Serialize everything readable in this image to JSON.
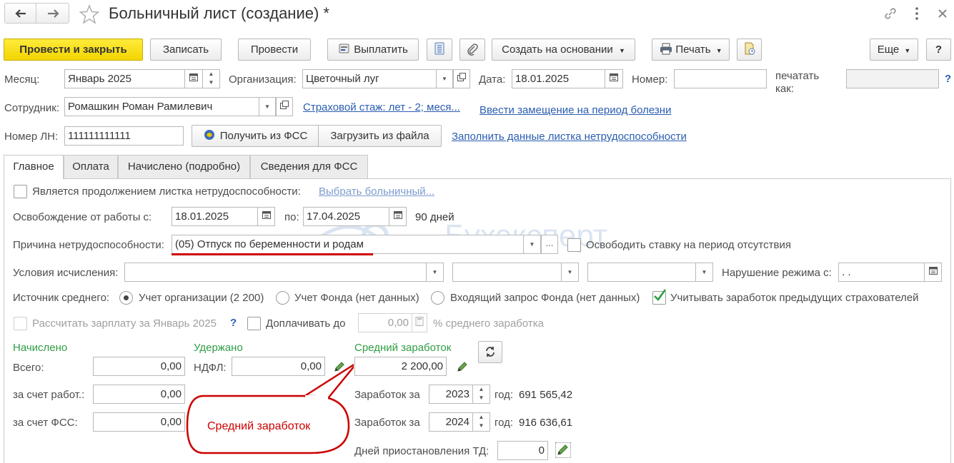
{
  "window": {
    "title": "Больничный лист (создание) *",
    "back_icon": "arrow-left-icon",
    "forward_icon": "arrow-right-icon",
    "favorite_icon": "star-icon",
    "link_icon": "link-icon",
    "more_icon": "vertical-dots-icon",
    "close_icon": "close-icon"
  },
  "toolbar": {
    "post_close": "Провести и закрыть",
    "save": "Записать",
    "post": "Провести",
    "pay": "Выплатить",
    "create_based": "Создать на основании",
    "print": "Печать",
    "more": "Еще",
    "help": "?"
  },
  "header": {
    "month_label": "Месяц:",
    "month_value": "Январь 2025",
    "org_label": "Организация:",
    "org_value": "Цветочный луг",
    "date_label": "Дата:",
    "date_value": "18.01.2025",
    "number_label": "Номер:",
    "number_value": "",
    "print_as_label": "печатать как:",
    "print_as_value": "",
    "help_q": "?",
    "employee_label": "Сотрудник:",
    "employee_value": "Ромашкин Роман Рамилевич",
    "insurance_link": "Страховой стаж: лет - 2; меся...",
    "substitute_link": "Ввести замещение на период болезни",
    "ln_label": "Номер ЛН:",
    "ln_value": "111111111111",
    "get_fss": "Получить из ФСС",
    "load_file": "Загрузить из файла",
    "fill_link": "Заполнить данные листка нетрудоспособности"
  },
  "tabs": [
    {
      "label": "Главное",
      "active": true
    },
    {
      "label": "Оплата",
      "active": false
    },
    {
      "label": "Начислено (подробно)",
      "active": false
    },
    {
      "label": "Сведения для ФСС",
      "active": false
    }
  ],
  "main": {
    "continuation_label": "Является продолжением листка нетрудоспособности:",
    "choose_sick_link": "Выбрать больничный...",
    "release_label": "Освобождение от работы с:",
    "release_from": "18.01.2025",
    "to_label": "по:",
    "release_to": "17.04.2025",
    "days": "90 дней",
    "reason_label": "Причина нетрудоспособности:",
    "reason_value": "(05) Отпуск по беременности и родам",
    "free_rate_label": "Освободить ставку на период отсутствия",
    "conditions_label": "Условия исчисления:",
    "violation_label": "Нарушение режима с:",
    "violation_value": " .  .",
    "avg_source_label": "Источник среднего:",
    "radio_org": "Учет организации (2 200)",
    "radio_fund": "Учет Фонда (нет данных)",
    "radio_incoming": "Входящий запрос Фонда (нет данных)",
    "prev_insurers_label": "Учитывать заработок предыдущих страхователей",
    "calc_salary_label": "Рассчитать зарплату за Январь 2025",
    "calc_q": "?",
    "topup_label": "Доплачивать до",
    "topup_value": "0,00",
    "pct_label": "% среднего заработка"
  },
  "totals": {
    "accrued_header": "Начислено",
    "withheld_header": "Удержано",
    "avg_header": "Средний заработок",
    "total_label": "Всего:",
    "total_value": "0,00",
    "ndfl_label": "НДФЛ:",
    "ndfl_value": "0,00",
    "avg_value": "2 200,00",
    "employer_label": "за счет работ.:",
    "employer_value": "0,00",
    "fss_label": "за счет ФСС:",
    "fss_value": "0,00",
    "earn_for_label_1": "Заработок за",
    "year_1": "2023",
    "year_label_1": "год:",
    "year_amount_1": "691 565,42",
    "earn_for_label_2": "Заработок за",
    "year_2": "2024",
    "year_label_2": "год:",
    "year_amount_2": "916 636,61",
    "suspend_label": "Дней приостановления ТД:",
    "suspend_value": "0"
  },
  "callout": {
    "text": "Средний заработок"
  },
  "watermark": "Бухэксперт",
  "colors": {
    "primary_button": "#f2d500",
    "link": "#2a5db0",
    "green_header": "#2f9e44",
    "callout_border": "#cc0000",
    "callout_text": "#cc0000"
  }
}
